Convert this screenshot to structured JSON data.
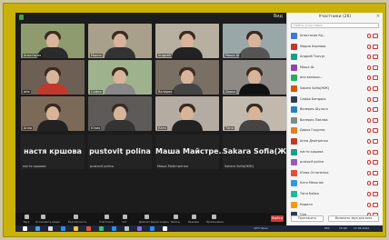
{
  "view_label": "Вид",
  "participants_panel": {
    "title": "Участники (26)",
    "search_placeholder": "Найти участника",
    "close": "×",
    "people": [
      {
        "name": "Анастасия Кр...",
        "color": "#3a7bd5"
      },
      {
        "name": "Мария Карпова",
        "color": "#c0392b"
      },
      {
        "name": "Андрей Ткачук",
        "color": "#16a085"
      },
      {
        "name": "Маша Ш.",
        "color": "#8e44ad"
      },
      {
        "name": "аня волоши...",
        "color": "#27ae60"
      },
      {
        "name": "Sakara Sofia(ЖЖ)",
        "color": "#d35400"
      },
      {
        "name": "Софья Бондарь",
        "color": "#2c3e50"
      },
      {
        "name": "Валерия Шульга",
        "color": "#2980b9"
      },
      {
        "name": "Валерия Павлюк",
        "color": "#7f8c8d"
      },
      {
        "name": "Дарья Гоцуляк",
        "color": "#e67e22"
      },
      {
        "name": "Анна Дмитренко",
        "color": "#c0392b"
      },
      {
        "name": "настя кршова",
        "color": "#16a085"
      },
      {
        "name": "pustovit polina",
        "color": "#9b59b6"
      },
      {
        "name": "Юлия Остапенко",
        "color": "#e74c3c"
      },
      {
        "name": "Катя Мельник",
        "color": "#3498db"
      },
      {
        "name": "Таня Бойко",
        "color": "#1abc9c"
      },
      {
        "name": "Кирилл",
        "color": "#f39c12"
      },
      {
        "name": "Оля",
        "color": "#2c3e50"
      }
    ],
    "invite_label": "Пригласить",
    "more_label": "Включить звук для всех"
  },
  "tiles": [
    {
      "label": "Анастасия",
      "bg": "#8d9b6e",
      "shirt": "#2b2b2b"
    },
    {
      "label": "Мария",
      "bg": "#a8a08a",
      "shirt": "#333"
    },
    {
      "label": "Андрей",
      "bg": "#b7b0a0",
      "shirt": "#222"
    },
    {
      "label": "Маша Ш.",
      "bg": "#9aa7a8",
      "shirt": "#555"
    },
    {
      "label": "аня",
      "bg": "#6e5f55",
      "shirt": "#c0392b"
    },
    {
      "label": "Софья",
      "bg": "#9fb28e",
      "shirt": "#888"
    },
    {
      "label": "Валерия",
      "bg": "#7a6f63",
      "shirt": "#444"
    },
    {
      "label": "Дарья",
      "bg": "#8d8a86",
      "shirt": "#111"
    },
    {
      "label": "Анна",
      "bg": "#7b6a58",
      "shirt": "#222"
    },
    {
      "label": "Юлия",
      "bg": "#5e5a58",
      "shirt": "#333"
    },
    {
      "label": "Катя",
      "bg": "#b4aba2",
      "shirt": "#222"
    },
    {
      "label": "Таня",
      "bg": "#c1b8ae",
      "shirt": "#444"
    }
  ],
  "name_tiles": [
    {
      "big": "настя кршова",
      "small": "настя кршова"
    },
    {
      "big": "pustovit polina",
      "small": "pustovit polina"
    },
    {
      "big": "Маша Майстре...",
      "small": "Маша Майстренко"
    },
    {
      "big": "Sakara Sofia(ЖЖ)",
      "small": "Sakara Sofia(ЖЖ)"
    }
  ],
  "toolbar": {
    "buttons": [
      {
        "label": "Звук"
      },
      {
        "label": "Остановить видео"
      },
      {
        "label": "Безопасность"
      },
      {
        "label": "Участники"
      },
      {
        "label": "Чат"
      },
      {
        "label": "Демонстрация экрана"
      },
      {
        "label": "Запись"
      },
      {
        "label": "Реакции"
      },
      {
        "label": "Приложения"
      }
    ],
    "end_label": "Выйти"
  },
  "taskbar": {
    "weather": "19°C  Ясно",
    "time": "15:44",
    "date": "17.05.2022",
    "lang": "РУС"
  }
}
